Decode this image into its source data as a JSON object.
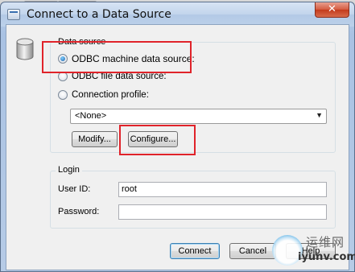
{
  "window": {
    "title": "Connect to a Data Source",
    "close_glyph": "✕"
  },
  "data_source": {
    "group_label": "Data source",
    "options": [
      {
        "label": "ODBC machine data source:",
        "selected": true
      },
      {
        "label": "ODBC file data source:",
        "selected": false
      },
      {
        "label": "Connection profile:",
        "selected": false
      }
    ],
    "profile_select": {
      "value": "<None>",
      "arrow_icon": "chevron-down-icon"
    },
    "modify_label": "Modify...",
    "configure_label": "Configure..."
  },
  "login": {
    "group_label": "Login",
    "user_id_label": "User ID:",
    "user_id_value": "root",
    "password_label": "Password:",
    "password_value": ""
  },
  "actions": {
    "connect_label": "Connect",
    "cancel_label": "Cancel",
    "help_label": "Help"
  },
  "watermark": {
    "chinese": "运维网",
    "url": "iyunv.com"
  },
  "colors": {
    "annotation": "#e0232a",
    "accent": "#3c7fb1"
  }
}
